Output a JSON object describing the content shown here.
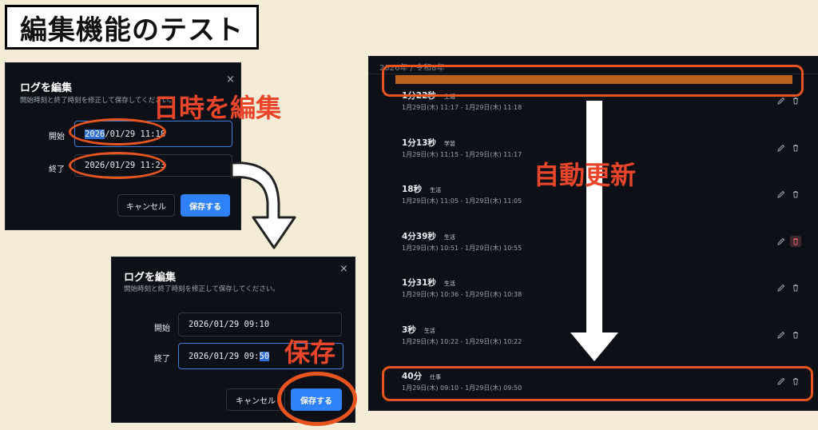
{
  "page_title": "編集機能のテスト",
  "dialog_before": {
    "title": "ログを編集",
    "subtitle": "開始時刻と終了時刻を修正して保存してください。",
    "close": "×",
    "start_label": "開始",
    "start_sel": "2026",
    "start_rest": "/01/29 11:18",
    "end_label": "終了",
    "end_value": "2026/01/29 11:23",
    "cancel_label": "キャンセル",
    "save_label": "保存する"
  },
  "dialog_after": {
    "title": "ログを編集",
    "subtitle": "開始時刻と終了時刻を修正して保存してください。",
    "close": "×",
    "start_label": "開始",
    "start_value": "2026/01/29 09:10",
    "end_label": "終了",
    "end_pre": "2026/01/29 09:",
    "end_sel": "50",
    "cancel_label": "キャンセル",
    "save_label": "保存する"
  },
  "annotations": {
    "edit_datetime": "日時を編集",
    "save": "保存",
    "auto_update": "自動更新"
  },
  "log_panel": {
    "header": "2026年 / 令和8年",
    "entries": [
      {
        "duration": "1分22秒",
        "category": "生活",
        "time": "1月29日(木) 11:17 - 1月29日(木) 11:18"
      },
      {
        "duration": "1分13秒",
        "category": "学習",
        "time": "1月29日(木) 11:15 - 1月29日(木) 11:17"
      },
      {
        "duration": "18秒",
        "category": "生活",
        "time": "1月29日(木) 11:05 - 1月29日(木) 11:05"
      },
      {
        "duration": "4分39秒",
        "category": "生活",
        "time": "1月29日(木) 10:51 - 1月29日(木) 10:55"
      },
      {
        "duration": "1分31秒",
        "category": "生活",
        "time": "1月29日(木) 10:36 - 1月29日(木) 10:38"
      },
      {
        "duration": "3秒",
        "category": "生活",
        "time": "1月29日(木) 10:22 - 1月29日(木) 10:22"
      },
      {
        "duration": "40分",
        "category": "仕事",
        "time": "1月29日(木) 09:10 - 1月29日(木) 09:50"
      }
    ]
  },
  "colors": {
    "annotation": "#e8452a",
    "accent_blue": "#2f81f7",
    "dark_bg": "#0d1117"
  }
}
